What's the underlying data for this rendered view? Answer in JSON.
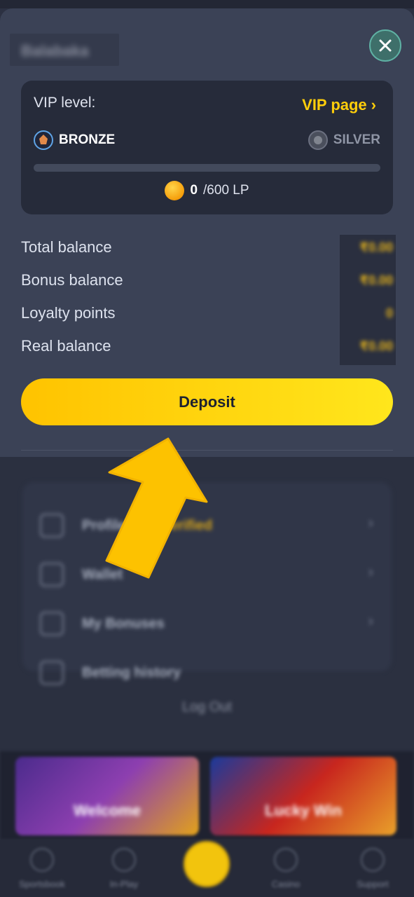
{
  "header": {
    "username": "Balabaka",
    "close_icon": "close-x-icon"
  },
  "vip": {
    "label": "VIP level:",
    "link": "VIP page",
    "link_chevron": "›",
    "current_tier": "BRONZE",
    "next_tier": "SILVER",
    "progress": 0,
    "points": "0",
    "points_max": "/600 LP"
  },
  "balances": [
    {
      "label": "Total balance",
      "value": "₹0.00"
    },
    {
      "label": "Bonus balance",
      "value": "₹0.00"
    },
    {
      "label": "Loyalty points",
      "value": "0"
    },
    {
      "label": "Real balance",
      "value": "₹0.00"
    }
  ],
  "deposit": {
    "label": "Deposit"
  },
  "menu": {
    "items": [
      {
        "label": "Profile",
        "note": "Unverified",
        "icon": "profile-icon"
      },
      {
        "label": "Wallet",
        "icon": "wallet-icon"
      },
      {
        "label": "My Bonuses",
        "icon": "gift-icon"
      },
      {
        "label": "Betting history",
        "icon": "history-icon"
      }
    ],
    "logout": "Log Out"
  },
  "banners": [
    {
      "text": "Welcome"
    },
    {
      "text": "Lucky Win"
    }
  ],
  "bottom_nav": [
    {
      "label": "Sportsbook"
    },
    {
      "label": "In-Play"
    },
    {
      "label": ""
    },
    {
      "label": "Casino"
    },
    {
      "label": "Support"
    }
  ],
  "colors": {
    "accent": "#ffce0a",
    "panel": "#3b4256",
    "card": "#262b3a",
    "arrow": "#fdc200"
  }
}
